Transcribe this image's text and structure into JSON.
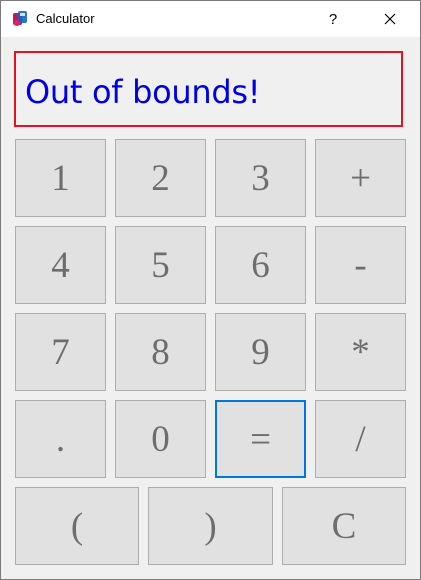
{
  "window": {
    "title": "Calculator",
    "help_glyph": "?",
    "close_glyph": "✕",
    "app_icon": "calculator-app-icon"
  },
  "display": {
    "text": "Out of bounds!",
    "text_color": "#0000e6",
    "border_color": "#e81123"
  },
  "keys": {
    "k1": "1",
    "k2": "2",
    "k3": "3",
    "plus": "+",
    "k4": "4",
    "k5": "5",
    "k6": "6",
    "minus": "-",
    "k7": "7",
    "k8": "8",
    "k9": "9",
    "multiply": "*",
    "dot": ".",
    "k0": "0",
    "equals": "=",
    "divide": "/",
    "lparen": "(",
    "rparen": ")",
    "clear": "C"
  },
  "focused_key": "equals",
  "colors": {
    "key_face": "#e1e1e1",
    "key_border": "#adadad",
    "focus_border": "#0078d7",
    "key_text": "#6d6d6d"
  }
}
